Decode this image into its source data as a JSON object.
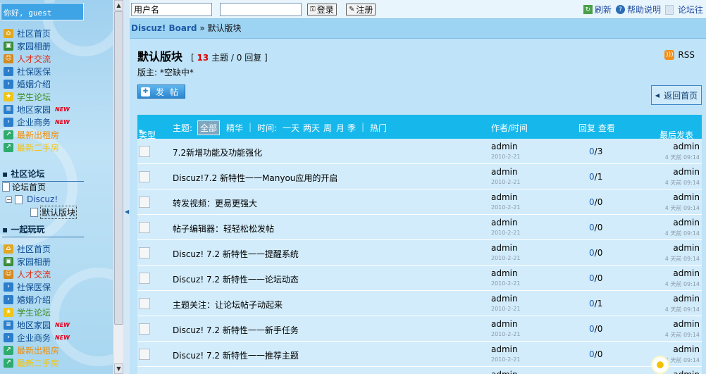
{
  "sidebar": {
    "greeting": "你好, guest",
    "menu1": [
      {
        "label": "社区首页",
        "color": "#0c4b91",
        "icon": "home-icon",
        "icon_color": "#e0a722",
        "new": false
      },
      {
        "label": "家园相册",
        "color": "#0c4b91",
        "icon": "photo-icon",
        "icon_color": "#3a8c3a",
        "new": false
      },
      {
        "label": "人才交流",
        "color": "#e3270e",
        "icon": "people-icon",
        "icon_color": "#d38a1e",
        "new": false
      },
      {
        "label": "社保医保",
        "color": "#0c4b91",
        "icon": "arrow-icon",
        "icon_color": "#2b7ecb",
        "new": false
      },
      {
        "label": "婚姻介绍",
        "color": "#0c4b91",
        "icon": "arrow-icon",
        "icon_color": "#2b7ecb",
        "new": false
      },
      {
        "label": "学生论坛",
        "color": "#3a8c20",
        "icon": "star-icon",
        "icon_color": "#f0c418",
        "new": false
      },
      {
        "label": "地区家园",
        "color": "#0c4b91",
        "icon": "doc-icon",
        "icon_color": "#2b7ecb",
        "new": true
      },
      {
        "label": "企业商务",
        "color": "#0c4b91",
        "icon": "arrow-icon",
        "icon_color": "#2b7ecb",
        "new": true
      },
      {
        "label": "最新出租房",
        "color": "#f08d00",
        "icon": "link-icon",
        "icon_color": "#2eac6d",
        "new": false
      },
      {
        "label": "最新二手房",
        "color": "#f2c40f",
        "icon": "link-icon",
        "icon_color": "#2eac6d",
        "new": false
      }
    ],
    "section1": "社区论坛",
    "tree": {
      "root": "论坛首页",
      "forum": "Discuz!",
      "board": "默认版块"
    },
    "section2": "一起玩玩",
    "menu2": [
      {
        "label": "社区首页",
        "color": "#0c4b91",
        "icon": "home-icon",
        "icon_color": "#e0a722",
        "new": false
      },
      {
        "label": "家园相册",
        "color": "#0c4b91",
        "icon": "photo-icon",
        "icon_color": "#3a8c3a",
        "new": false
      },
      {
        "label": "人才交流",
        "color": "#e3270e",
        "icon": "people-icon",
        "icon_color": "#d38a1e",
        "new": false
      },
      {
        "label": "社保医保",
        "color": "#0c4b91",
        "icon": "arrow-icon",
        "icon_color": "#2b7ecb",
        "new": false
      },
      {
        "label": "婚姻介绍",
        "color": "#0c4b91",
        "icon": "arrow-icon",
        "icon_color": "#2b7ecb",
        "new": false
      },
      {
        "label": "学生论坛",
        "color": "#3a8c20",
        "icon": "star-icon",
        "icon_color": "#f0c418",
        "new": false
      },
      {
        "label": "地区家园",
        "color": "#0c4b91",
        "icon": "doc-icon",
        "icon_color": "#2b7ecb",
        "new": true
      },
      {
        "label": "企业商务",
        "color": "#0c4b91",
        "icon": "arrow-icon",
        "icon_color": "#2b7ecb",
        "new": true
      },
      {
        "label": "最新出租房",
        "color": "#f08d00",
        "icon": "link-icon",
        "icon_color": "#2eac6d",
        "new": false
      },
      {
        "label": "最新二手房",
        "color": "#f2c40f",
        "icon": "link-icon",
        "icon_color": "#2eac6d",
        "new": false
      }
    ],
    "new_label": "NEW"
  },
  "topbar": {
    "username_value": "用户名",
    "password_value": "",
    "login_label": "登录",
    "register_label": "注册",
    "refresh_label": "刷新",
    "help_label": "帮助说明",
    "forum_label": "论坛往"
  },
  "breadcrumb": {
    "home": "Discuz! Board",
    "sep": " » ",
    "current": "默认版块"
  },
  "forum": {
    "name": "默认版块",
    "count_open": "[",
    "threads_num": "13",
    "threads_word": "主题",
    "replies_text": "/ 0 回复",
    "count_close": "]",
    "moderator": "版主: *空缺中*",
    "rss": "RSS",
    "post_button": "发帖",
    "back_button": "返回首页"
  },
  "table_header": {
    "type": "类型",
    "theme_label": "主题:",
    "all": "全部",
    "digest": "精华",
    "time_label": "时间:",
    "day": "一天",
    "two_days": "两天",
    "week": "周",
    "month": "月",
    "season": "季",
    "hot": "热门",
    "author_time": "作者/时间",
    "reply_view": "回复 查看",
    "last_post": "最后发表"
  },
  "threads": [
    {
      "title": "7.2新增功能及功能强化",
      "author": "admin",
      "date": "2010-2-21",
      "replies": "0",
      "views": "3",
      "last_author": "admin",
      "last_time": "4 天前 09:14"
    },
    {
      "title": "Discuz!7.2 新特性一一Manyou应用的开启",
      "author": "admin",
      "date": "2010-2-21",
      "replies": "0",
      "views": "1",
      "last_author": "admin",
      "last_time": "4 天前 09:14"
    },
    {
      "title": "转发视频：更易更强大",
      "author": "admin",
      "date": "2010-2-21",
      "replies": "0",
      "views": "0",
      "last_author": "admin",
      "last_time": "4 天前 09:14"
    },
    {
      "title": "帖子编辑器：轻轻松松发帖",
      "author": "admin",
      "date": "2010-2-21",
      "replies": "0",
      "views": "0",
      "last_author": "admin",
      "last_time": "4 天前 09:14"
    },
    {
      "title": "Discuz! 7.2 新特性一一提醒系统",
      "author": "admin",
      "date": "2010-2-21",
      "replies": "0",
      "views": "0",
      "last_author": "admin",
      "last_time": "4 天前 09:14"
    },
    {
      "title": "Discuz! 7.2 新特性一一论坛动态",
      "author": "admin",
      "date": "2010-2-21",
      "replies": "0",
      "views": "0",
      "last_author": "admin",
      "last_time": "4 天前 09:14"
    },
    {
      "title": "主题关注：让论坛帖子动起来",
      "author": "admin",
      "date": "2010-2-21",
      "replies": "0",
      "views": "1",
      "last_author": "admin",
      "last_time": "4 天前 09:14"
    },
    {
      "title": "Discuz! 7.2 新特性一一新手任务",
      "author": "admin",
      "date": "2010-2-21",
      "replies": "0",
      "views": "0",
      "last_author": "admin",
      "last_time": "4 天前 09:14"
    },
    {
      "title": "Discuz! 7.2 新特性一一推荐主题",
      "author": "admin",
      "date": "2010-2-21",
      "replies": "0",
      "views": "0",
      "last_author": "admin",
      "last_time": "4 天前 09:14"
    },
    {
      "title": "",
      "author": "admin",
      "date": "",
      "replies": "",
      "views": "",
      "last_author": "admin",
      "last_time": ""
    }
  ]
}
